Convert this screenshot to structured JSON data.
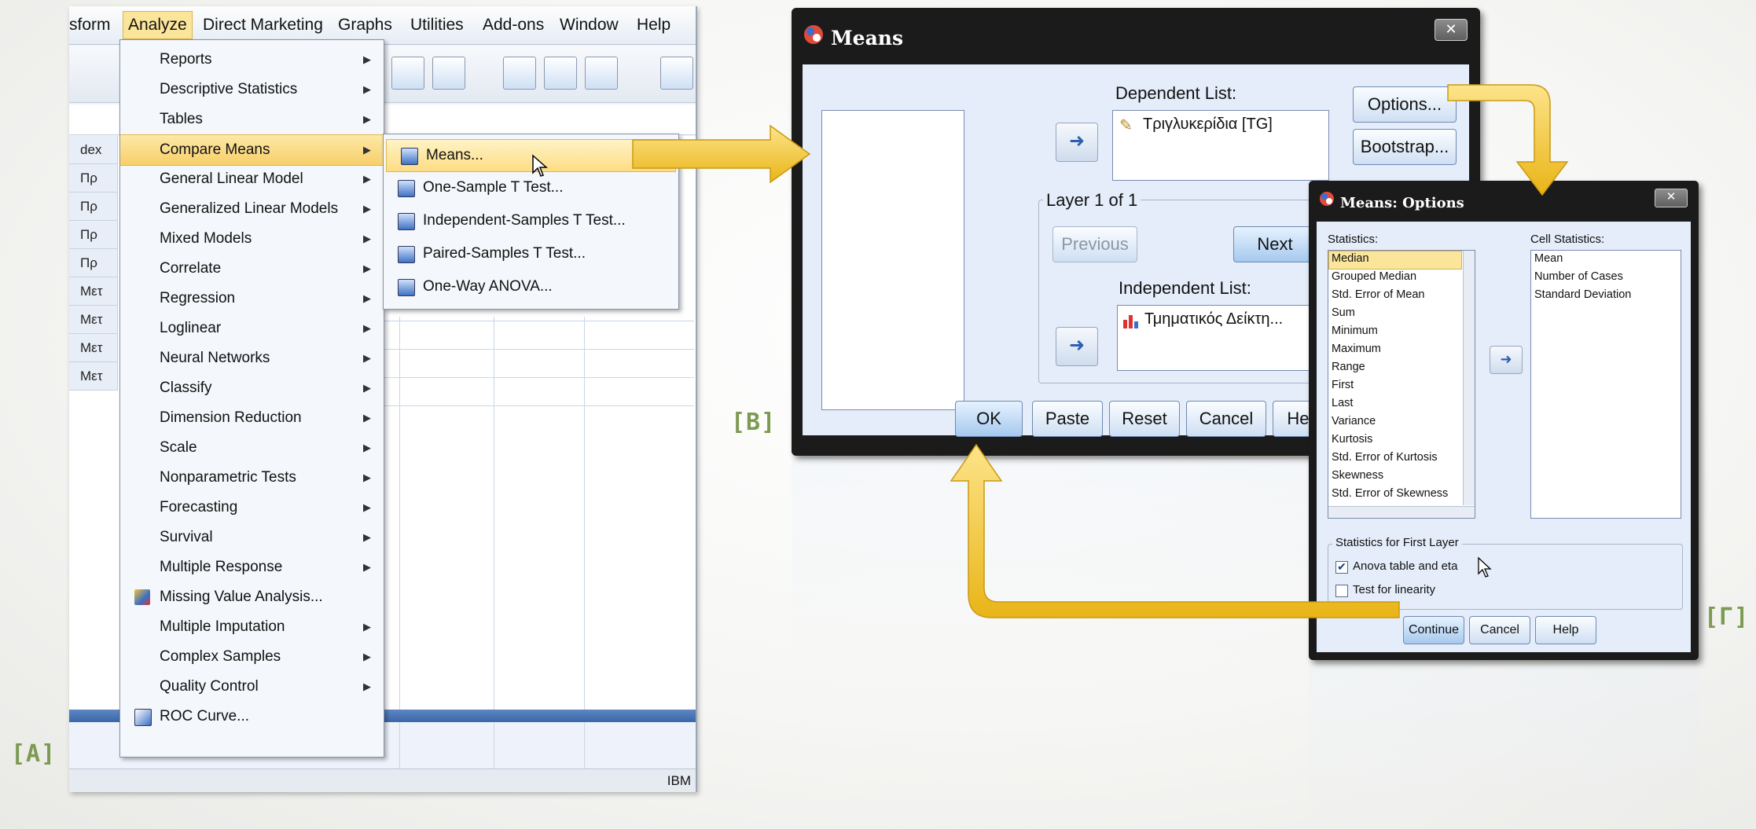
{
  "menubar": {
    "items": [
      "sform",
      "Analyze",
      "Direct Marketing",
      "Graphs",
      "Utilities",
      "Add-ons",
      "Window",
      "Help"
    ],
    "active": "Analyze"
  },
  "grid": {
    "col_header": "dex",
    "rows": [
      "Πρ",
      "Πρ",
      "Πρ",
      "Πρ",
      "Μετ",
      "Μετ",
      "Μετ",
      "Μετ"
    ]
  },
  "status_text": "IBM",
  "analyze_menu": {
    "items": [
      {
        "label": "Reports",
        "submenu": true
      },
      {
        "label": "Descriptive Statistics",
        "submenu": true
      },
      {
        "label": "Tables",
        "submenu": true
      },
      {
        "label": "Compare Means",
        "submenu": true
      },
      {
        "label": "General Linear Model",
        "submenu": true
      },
      {
        "label": "Generalized Linear Models",
        "submenu": true
      },
      {
        "label": "Mixed Models",
        "submenu": true
      },
      {
        "label": "Correlate",
        "submenu": true
      },
      {
        "label": "Regression",
        "submenu": true
      },
      {
        "label": "Loglinear",
        "submenu": true
      },
      {
        "label": "Neural Networks",
        "submenu": true
      },
      {
        "label": "Classify",
        "submenu": true
      },
      {
        "label": "Dimension Reduction",
        "submenu": true
      },
      {
        "label": "Scale",
        "submenu": true
      },
      {
        "label": "Nonparametric Tests",
        "submenu": true
      },
      {
        "label": "Forecasting",
        "submenu": true
      },
      {
        "label": "Survival",
        "submenu": true
      },
      {
        "label": "Multiple Response",
        "submenu": true
      },
      {
        "label": "Missing Value Analysis...",
        "submenu": false
      },
      {
        "label": "Multiple Imputation",
        "submenu": true
      },
      {
        "label": "Complex Samples",
        "submenu": true
      },
      {
        "label": "Quality Control",
        "submenu": true
      },
      {
        "label": "ROC Curve...",
        "submenu": false
      }
    ],
    "highlighted": "Compare Means"
  },
  "compare_means_submenu": {
    "items": [
      "Means...",
      "One-Sample T Test...",
      "Independent-Samples T Test...",
      "Paired-Samples T Test...",
      "One-Way ANOVA..."
    ],
    "highlighted": "Means..."
  },
  "means_dialog": {
    "title": "Means",
    "close_glyph": "✕",
    "dependent_label": "Dependent List:",
    "dependent_item": "Τριγλυκερίδια [TG]",
    "layer_label": "Layer 1 of 1",
    "previous": "Previous",
    "next": "Next",
    "independent_label": "Independent List:",
    "independent_item": "Τμηματικός Δείκτη...",
    "options": "Options...",
    "bootstrap": "Bootstrap...",
    "ok": "OK",
    "paste": "Paste",
    "reset": "Reset",
    "cancel": "Cancel",
    "help": "Help"
  },
  "options_dialog": {
    "title": "Means: Options",
    "close_glyph": "✕",
    "statistics_label": "Statistics:",
    "statistics": [
      "Median",
      "Grouped Median",
      "Std. Error of Mean",
      "Sum",
      "Minimum",
      "Maximum",
      "Range",
      "First",
      "Last",
      "Variance",
      "Kurtosis",
      "Std. Error of Kurtosis",
      "Skewness",
      "Std. Error of Skewness"
    ],
    "selected_statistic": "Median",
    "cell_statistics_label": "Cell Statistics:",
    "cell_statistics": [
      "Mean",
      "Number of Cases",
      "Standard Deviation"
    ],
    "first_layer_group": "Statistics for First Layer",
    "anova_checkbox": "Anova table and eta",
    "anova_checked": true,
    "linearity_checkbox": "Test for linearity",
    "linearity_checked": false,
    "continue": "Continue",
    "cancel": "Cancel",
    "help": "Help"
  },
  "tags": {
    "a": "[A]",
    "b": "[B]",
    "g": "[Γ]"
  },
  "colors": {
    "arrow": "#f3c62c",
    "highlight": "#fbe59b",
    "tag": "#7c9a52"
  }
}
